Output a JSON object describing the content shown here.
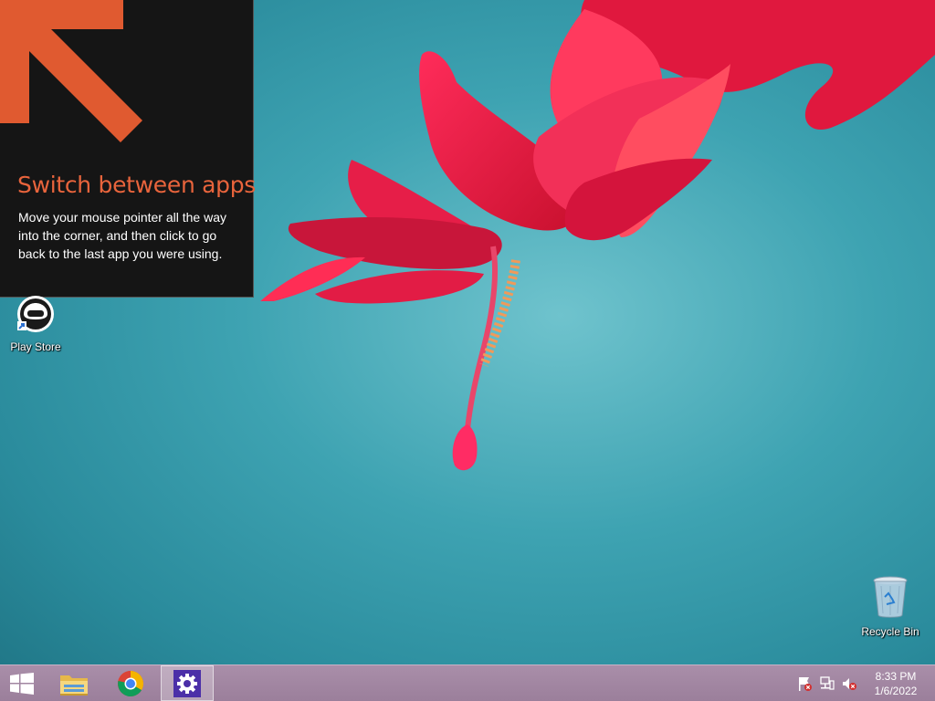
{
  "tip": {
    "title": "Switch between apps",
    "body": "Move your mouse pointer all the way into the corner, and then click to go back to the last app you were using."
  },
  "desktop_icons": [
    {
      "label": "Play Store",
      "icon": "play-store-icon"
    },
    {
      "label": "Recycle Bin",
      "icon": "recycle-bin-icon"
    }
  ],
  "taskbar": {
    "pinned": [
      {
        "name": "start",
        "icon": "windows-logo-icon"
      },
      {
        "name": "file-explorer",
        "icon": "folder-icon"
      },
      {
        "name": "chrome",
        "icon": "chrome-icon"
      },
      {
        "name": "settings",
        "icon": "gear-icon",
        "active": true
      }
    ],
    "tray": [
      "action-center-flag-icon",
      "network-icon",
      "volume-muted-icon"
    ],
    "clock": {
      "time": "8:33 PM",
      "date": "1/6/2022"
    }
  },
  "colors": {
    "accent": "#e8643c",
    "tip_background": "#151515",
    "taskbar": "#a98ea9",
    "settings_tile": "#4b2fa8"
  }
}
